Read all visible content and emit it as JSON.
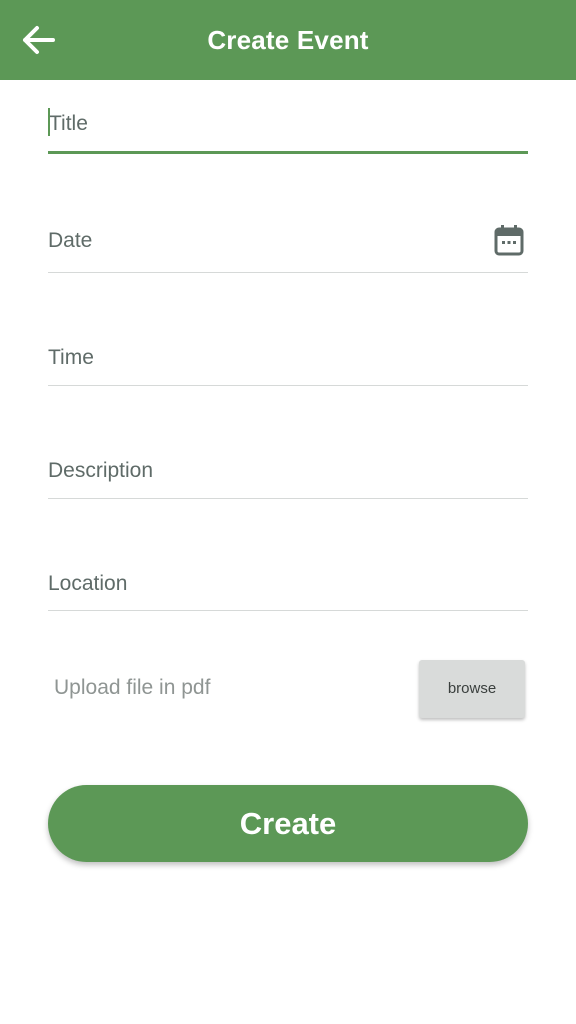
{
  "header": {
    "title": "Create Event",
    "back_icon": "arrow-left-icon"
  },
  "form": {
    "title": {
      "placeholder": "Title",
      "value": ""
    },
    "date": {
      "placeholder": "Date",
      "value": "",
      "icon": "calendar-icon"
    },
    "time": {
      "placeholder": "Time",
      "value": ""
    },
    "description": {
      "placeholder": "Description",
      "value": ""
    },
    "location": {
      "placeholder": "Location",
      "value": ""
    },
    "upload": {
      "label": "Upload file in pdf",
      "browse_label": "browse"
    },
    "submit_label": "Create"
  },
  "colors": {
    "primary": "#5c9856",
    "text": "#33403a",
    "hint": "#5f6b68",
    "divider": "#d6d9d8",
    "browse_bg": "#d9dbda"
  }
}
